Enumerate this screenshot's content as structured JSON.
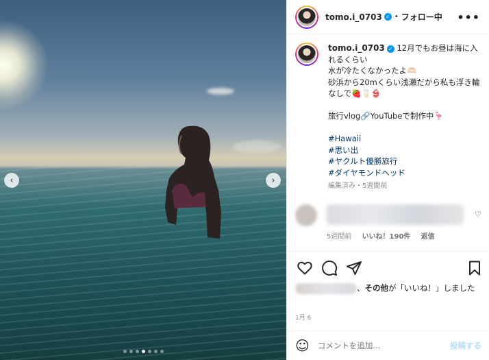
{
  "post": {
    "username": "tomo.i_0703",
    "follow_label": "フォロー中",
    "bullet": "•",
    "more_label": "•••"
  },
  "caption": {
    "username": "tomo.i_0703",
    "line1": "12月でもお昼は海に入れるくらい",
    "line2": "水が冷たくなかったよ🫶🏻",
    "line3": "砂浜から20mくらい浅瀬だから私も浮き輪なしで🍓🥛👙",
    "line4": "旅行vlog🔗YouTubeで制作中🦩",
    "hashtags": [
      "#Hawaii",
      "#思い出",
      "#ヤクルト優勝旅行",
      "#ダイヤモンドヘッド"
    ],
    "meta": "編集済み・5週間前"
  },
  "comment": {
    "time": "5週間前",
    "likes": "いいね！190件",
    "reply": "返信"
  },
  "likes": {
    "text_before": "、",
    "others": "その他",
    "text_after": "が「いいね！」しました"
  },
  "date": "1月 6",
  "add_comment": {
    "placeholder": "コメントを追加...",
    "post_label": "投稿する"
  },
  "carousel": {
    "slide_count": 7,
    "active_index": 3
  },
  "colors": {
    "link": "#00376b",
    "verified": "#0095f6",
    "post_button": "#b2dffc"
  }
}
